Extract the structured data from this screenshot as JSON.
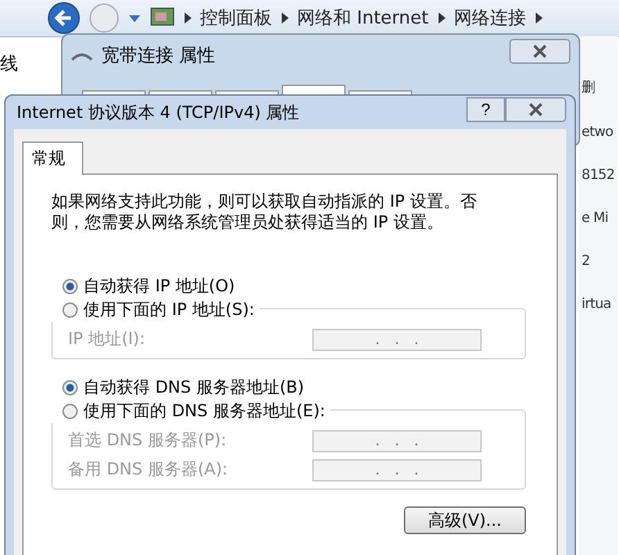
{
  "explorer": {
    "breadcrumb": [
      "控制面板",
      "网络和 Internet",
      "网络连接"
    ],
    "left_fragment": "线",
    "right_fragments": [
      "删",
      "etwo",
      "8152",
      "e Mi",
      "2",
      "irtua"
    ]
  },
  "back_dialog": {
    "title": "宽带连接 属性",
    "tabs": [
      {
        "selected": false
      },
      {
        "selected": false
      },
      {
        "selected": false
      },
      {
        "selected": true
      },
      {
        "selected": false
      }
    ]
  },
  "dialog": {
    "title": "Internet 协议版本 4 (TCP/IPv4) 属性",
    "help": "?",
    "tabs": [
      {
        "label": "常规",
        "selected": true
      }
    ],
    "description": "如果网络支持此功能，则可以获取自动指派的 IP 设置。否则，您需要从网络系统管理员处获得适当的 IP 设置。",
    "sections": [
      {
        "auto": {
          "label": "自动获得 IP 地址(O)",
          "selected": true
        },
        "manual": {
          "label": "使用下面的 IP 地址(S):",
          "selected": false
        },
        "disabled": true,
        "fields": [
          {
            "label": "IP 地址(I):",
            "value": ".   .   ."
          }
        ]
      },
      {
        "auto": {
          "label": "自动获得 DNS 服务器地址(B)",
          "selected": true
        },
        "manual": {
          "label": "使用下面的 DNS 服务器地址(E):",
          "selected": false
        },
        "disabled": true,
        "fields": [
          {
            "label": "首选 DNS 服务器(P):",
            "value": ".   .   ."
          },
          {
            "label": "备用 DNS 服务器(A):",
            "value": ".   .   ."
          }
        ]
      }
    ],
    "advanced_button": "高级(V)..."
  }
}
